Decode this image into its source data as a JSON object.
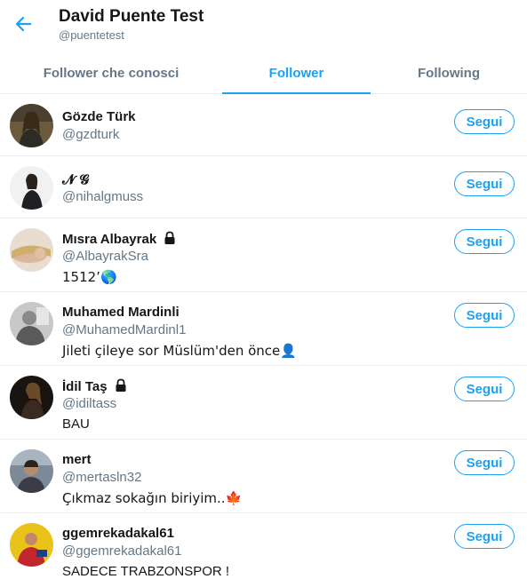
{
  "header": {
    "title": "David Puente Test",
    "handle": "@puentetest",
    "back_icon": "arrow-left-icon",
    "accent_color": "#1da1f2"
  },
  "tabs": [
    {
      "label": "Follower che conosci",
      "active": false
    },
    {
      "label": "Follower",
      "active": true
    },
    {
      "label": "Following",
      "active": false
    }
  ],
  "users": [
    {
      "name": "Gözde Türk",
      "handle": "@gzdturk",
      "bio": "",
      "locked": false,
      "button": "Segui"
    },
    {
      "name": "𝓝 𝓖",
      "handle": "@nihalgmuss",
      "bio": "",
      "locked": false,
      "button": "Segui"
    },
    {
      "name": "Mısra Albayrak",
      "handle": "@AlbayrakSra",
      "bio": "1512’🌎",
      "locked": true,
      "button": "Segui"
    },
    {
      "name": "Muhamed Mardinli",
      "handle": "@MuhamedMardinl1",
      "bio": "Jileti çileye sor Müslüm'den önce👤",
      "locked": false,
      "button": "Segui"
    },
    {
      "name": "İdil Taş",
      "handle": "@idiltass",
      "bio": "BAU",
      "locked": true,
      "button": "Segui"
    },
    {
      "name": "mert",
      "handle": "@mertasln32",
      "bio": "Çıkmaz sokağın biriyim..🍁",
      "locked": false,
      "button": "Segui"
    },
    {
      "name": "ggemrekadakal61",
      "handle": "@ggemrekadakal61",
      "bio": "SADECE TRABZONSPOR !",
      "locked": false,
      "button": "Segui"
    }
  ]
}
